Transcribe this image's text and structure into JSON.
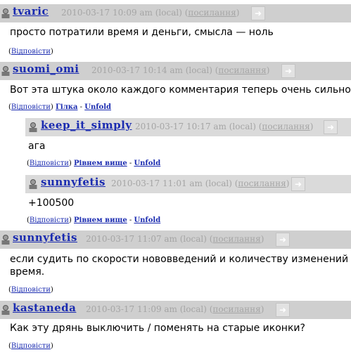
{
  "comments": [
    {
      "user": "tvaric",
      "meta_time": "2010-03-17 10:09 am (local)",
      "meta_link": "посилання",
      "text": [
        "просто потратили время и деньги, смысла — ноль"
      ],
      "links": [
        "Відповісти"
      ]
    },
    {
      "user": "suomi_omi",
      "meta_time": "2010-03-17 10:14 am (local)",
      "meta_link": "посилання",
      "text": [
        "Вот эта штука около каждого комментария теперь очень сильно в"
      ],
      "links": [
        "Відповісти",
        "Гілка",
        "Unfold"
      ]
    },
    {
      "user": "keep_it_simply",
      "meta_time": "2010-03-17 10:17 am (local)",
      "meta_link": "посилання",
      "text": [
        "ага"
      ],
      "links": [
        "Відповісти",
        "Рівнем вище",
        "Unfold"
      ]
    },
    {
      "user": "sunnyfetis",
      "meta_time": "2010-03-17 11:01 am (local)",
      "meta_link": "посилання",
      "text": [
        "+100500"
      ],
      "links": [
        "Відповісти",
        "Рівнем вище",
        "Unfold"
      ]
    },
    {
      "user": "sunnyfetis",
      "meta_time": "2010-03-17 11:07 am (local)",
      "meta_link": "посилання",
      "text": [
        "если судить по скорости нововведений и количеству изменений в н",
        "время."
      ],
      "links": [
        "Відповісти"
      ]
    },
    {
      "user": "kastaneda",
      "meta_time": "2010-03-17 11:09 am (local)",
      "meta_link": "посилання",
      "text": [
        "Как эту дрянь выключить / поменять на старые иконки?"
      ],
      "links": [
        "Відповісти"
      ]
    }
  ],
  "colors": {
    "link": "#1a2bb0",
    "header_bg": "#cfcfcf",
    "meta": "#a5a5a5"
  },
  "icons": {
    "user": "user-icon",
    "forward": "arrow-icon"
  }
}
